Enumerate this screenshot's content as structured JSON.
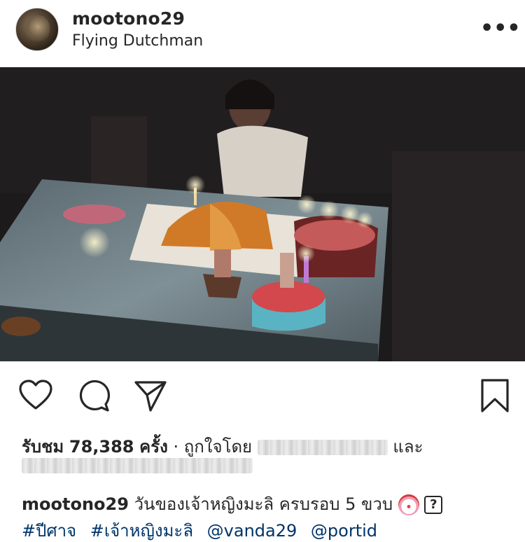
{
  "post": {
    "username": "mootono29",
    "location": "Flying Dutchman"
  },
  "icons": {
    "avatar": "avatar-image",
    "more": "more-options-icon",
    "like": "heart-icon",
    "comment": "comment-icon",
    "share": "send-icon",
    "save": "bookmark-icon",
    "caption_emoji": "clown-emoji",
    "unknown_glyph": "missing-glyph-box"
  },
  "more_label": "•••",
  "stats": {
    "views_label": "รับชม",
    "views_count": "78,388",
    "views_unit": "ครั้ง",
    "separator": "·",
    "liked_by_label": "ถูกใจโดย",
    "and_label": "และ"
  },
  "caption": {
    "username": "mootono29",
    "text": "วันของเจ้าหญิงมะลิ ครบรอบ 5 ขวบ",
    "unknown_char": "?",
    "hashtags": [
      "#ปีศาจ",
      "#เจ้าหญิงมะลิ",
      "@vanda29",
      "@portid"
    ]
  },
  "colors": {
    "text": "#262626",
    "link": "#003569",
    "background": "#ffffff"
  }
}
